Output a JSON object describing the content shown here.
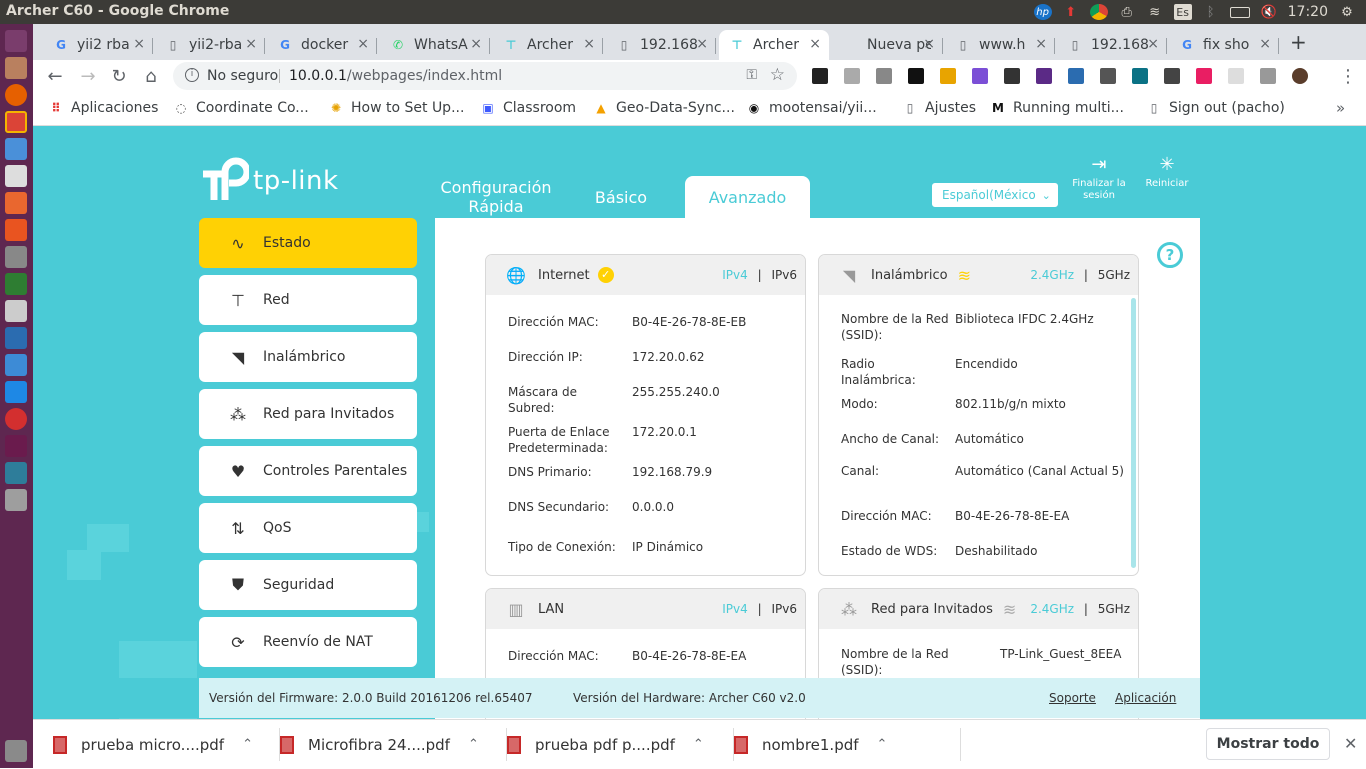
{
  "window": {
    "title": "Archer C60 - Google Chrome"
  },
  "tray": {
    "keyboard": "Es",
    "time": "17:20"
  },
  "tabs": [
    {
      "label": "yii2 rba",
      "icon": "google-icon"
    },
    {
      "label": "yii2-rba",
      "icon": "page-icon"
    },
    {
      "label": "docker",
      "icon": "google-icon"
    },
    {
      "label": "WhatsA",
      "icon": "whatsapp-icon"
    },
    {
      "label": "Archer",
      "icon": "tplink-icon"
    },
    {
      "label": "192.168",
      "icon": "page-icon"
    },
    {
      "label": "Archer",
      "icon": "tplink-icon",
      "active": true
    },
    {
      "label": "Nueva pes",
      "icon": "none"
    },
    {
      "label": "www.h",
      "icon": "page-icon"
    },
    {
      "label": "192.168",
      "icon": "page-icon"
    },
    {
      "label": "fix sho",
      "icon": "google-icon"
    }
  ],
  "omnibox": {
    "security": "No seguro",
    "url_host": "10.0.0.1",
    "url_path": "/webpages/index.html"
  },
  "bookmarks": [
    {
      "label": "Aplicaciones",
      "icon": "apps-grid-icon"
    },
    {
      "label": "Coordinate Co...",
      "icon": "loading-circle-icon"
    },
    {
      "label": "How to Set Up...",
      "icon": "gear-icon"
    },
    {
      "label": "Classroom",
      "icon": "classroom-icon"
    },
    {
      "label": "Geo-Data-Sync...",
      "icon": "flame-icon"
    },
    {
      "label": "mootensai/yii...",
      "icon": "github-icon"
    },
    {
      "label": "Ajustes",
      "icon": "page-icon"
    },
    {
      "label": "Running multi...",
      "icon": "medium-icon"
    },
    {
      "label": "Sign out (pacho)",
      "icon": "page-icon"
    }
  ],
  "router": {
    "brand": "tp-link",
    "main_tabs": [
      "Configuración Rápida",
      "Básico",
      "Avanzado"
    ],
    "language": "Español(México",
    "logout": "Finalizar la sesión",
    "reboot": "Reiniciar",
    "nav": [
      {
        "label": "Estado",
        "icon": "pulse-icon"
      },
      {
        "label": "Red",
        "icon": "network-icon"
      },
      {
        "label": "Inalámbrico",
        "icon": "wireless-icon"
      },
      {
        "label": "Red para Invitados",
        "icon": "guests-icon"
      },
      {
        "label": "Controles Parentales",
        "icon": "heart-icon"
      },
      {
        "label": "QoS",
        "icon": "qos-arrows-icon"
      },
      {
        "label": "Seguridad",
        "icon": "shield-icon"
      },
      {
        "label": "Reenvío de NAT",
        "icon": "nat-icon"
      }
    ],
    "internet": {
      "title": "Internet",
      "ipv4": "IPv4",
      "sep": "|",
      "ipv6": "IPv6",
      "rows": [
        {
          "k": "Dirección MAC:",
          "v": "B0-4E-26-78-8E-EB"
        },
        {
          "k": "Dirección IP:",
          "v": "172.20.0.62"
        },
        {
          "k": "Máscara de Subred:",
          "v": "255.255.240.0"
        },
        {
          "k": "Puerta de Enlace Predeterminada:",
          "v": "172.20.0.1"
        },
        {
          "k": "DNS Primario:",
          "v": "192.168.79.9"
        },
        {
          "k": "DNS Secundario:",
          "v": "0.0.0.0"
        },
        {
          "k": "Tipo de Conexión:",
          "v": "IP Dinámico"
        }
      ]
    },
    "wireless": {
      "title": "Inalámbrico",
      "b24": "2.4GHz",
      "sep": "|",
      "b5": "5GHz",
      "rows": [
        {
          "k": "Nombre de la Red (SSID):",
          "v": "Biblioteca IFDC 2.4GHz"
        },
        {
          "k": "Radio Inalámbrica:",
          "v": "Encendido"
        },
        {
          "k": "Modo:",
          "v": "802.11b/g/n mixto"
        },
        {
          "k": "Ancho de Canal:",
          "v": "Automático"
        },
        {
          "k": "Canal:",
          "v": "Automático (Canal Actual 5)"
        },
        {
          "k": "Dirección MAC:",
          "v": "B0-4E-26-78-8E-EA"
        },
        {
          "k": "Estado de WDS:",
          "v": "Deshabilitado"
        }
      ]
    },
    "lan": {
      "title": "LAN",
      "ipv4": "IPv4",
      "sep": "|",
      "ipv6": "IPv6",
      "rows": [
        {
          "k": "Dirección MAC:",
          "v": "B0-4E-26-78-8E-EA"
        }
      ]
    },
    "guest": {
      "title": "Red para Invitados",
      "b24": "2.4GHz",
      "sep": "|",
      "b5": "5GHz",
      "rows": [
        {
          "k": "Nombre de la Red (SSID):",
          "v": "TP-Link_Guest_8EEA"
        }
      ]
    },
    "footer": {
      "firmware": "Versión del Firmware: 2.0.0 Build 20161206 rel.65407",
      "hardware": "Versión del Hardware: Archer C60 v2.0",
      "support": "Soporte",
      "app": "Aplicación"
    }
  },
  "downloads": {
    "items": [
      "prueba micro....pdf",
      "Microfibra 24....pdf",
      "prueba pdf p....pdf",
      "nombre1.pdf"
    ],
    "show_all": "Mostrar todo"
  },
  "colors": {
    "accent": "#4acbd6",
    "active_nav": "#ffd104",
    "launcher": "#5e2750"
  }
}
